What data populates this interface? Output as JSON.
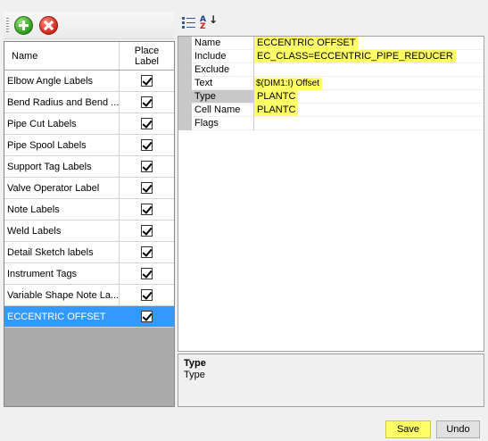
{
  "toolbar": {
    "add_icon": "add-icon",
    "delete_icon": "delete-icon"
  },
  "label_grid": {
    "headers": {
      "name": "Name",
      "place_line1": "Place",
      "place_line2": "Label"
    },
    "rows": [
      {
        "name": "Elbow Angle Labels",
        "checked": true
      },
      {
        "name": "Bend Radius and Bend ...",
        "checked": true
      },
      {
        "name": "Pipe Cut Labels",
        "checked": true
      },
      {
        "name": "Pipe Spool Labels",
        "checked": true
      },
      {
        "name": "Support Tag Labels",
        "checked": true
      },
      {
        "name": "Valve Operator Label",
        "checked": true
      },
      {
        "name": "Note Labels",
        "checked": true
      },
      {
        "name": "Weld Labels",
        "checked": true
      },
      {
        "name": "Detail Sketch labels",
        "checked": true
      },
      {
        "name": "Instrument Tags",
        "checked": true
      },
      {
        "name": "Variable Shape Note La...",
        "checked": true
      },
      {
        "name": "ECCENTRIC OFFSET",
        "checked": true,
        "selected": true
      }
    ]
  },
  "property_grid": {
    "toolbar_icons": [
      "categorized-icon",
      "alphabetical-icon"
    ],
    "rows": [
      {
        "name": "Name",
        "value": "ECCENTRIC OFFSET",
        "highlight": true
      },
      {
        "name": "Include",
        "value": "EC_CLASS=ECCENTRIC_PIPE_REDUCER",
        "highlight": true
      },
      {
        "name": "Exclude",
        "value": ""
      },
      {
        "name": "Text",
        "value": "$(DIM1:I) Offset",
        "highlight": true
      },
      {
        "name": "Type",
        "value": "PLANTC",
        "highlight": true,
        "selected": true
      },
      {
        "name": "Cell Name",
        "value": "PLANTC",
        "highlight": true
      },
      {
        "name": "Flags",
        "value": ""
      }
    ]
  },
  "help": {
    "title": "Type",
    "description": "Type"
  },
  "buttons": {
    "save": "Save",
    "undo": "Undo"
  },
  "colors": {
    "highlight": "#ffff66",
    "selection": "#3399ff"
  }
}
